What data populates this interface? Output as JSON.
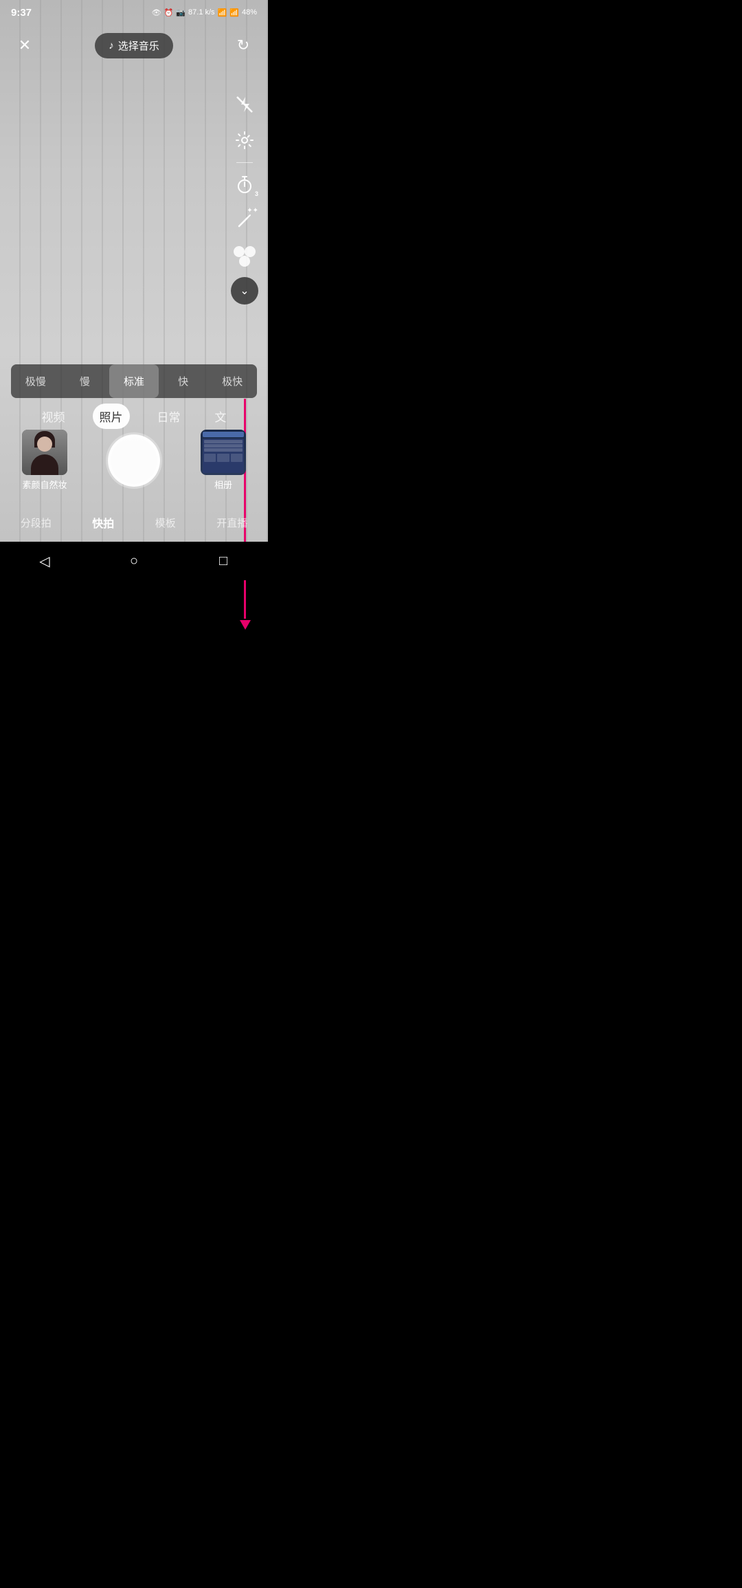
{
  "statusBar": {
    "time": "9:37",
    "batteryPercent": "48%",
    "networkSpeed": "87.1 k/s"
  },
  "topBar": {
    "closeLabel": "×",
    "musicLabel": "选择音乐",
    "rotateLabel": "↺"
  },
  "rightControls": {
    "flashLabel": "flash-off",
    "settingsLabel": "settings",
    "timerLabel": "timer",
    "timerBadge": "3",
    "magicLabel": "magic-wand",
    "beautyLabel": "beauty",
    "chevronLabel": "chevron-down"
  },
  "speedOptions": [
    {
      "label": "极慢",
      "active": false
    },
    {
      "label": "慢",
      "active": false
    },
    {
      "label": "标准",
      "active": true
    },
    {
      "label": "快",
      "active": false
    },
    {
      "label": "极快",
      "active": false
    }
  ],
  "modeTabs": [
    {
      "label": "视频",
      "active": false
    },
    {
      "label": "照片",
      "active": true
    },
    {
      "label": "日常",
      "active": false
    },
    {
      "label": "文",
      "active": false
    }
  ],
  "cameraControls": {
    "galleryLabel": "素颜自然妆",
    "albumLabel": "相册"
  },
  "bottomNav": [
    {
      "label": "分段拍",
      "active": false
    },
    {
      "label": "快拍",
      "active": true
    },
    {
      "label": "模板",
      "active": false
    },
    {
      "label": "开直播",
      "active": false
    }
  ],
  "sysNav": {
    "backLabel": "◁",
    "homeLabel": "○",
    "recentLabel": "□"
  }
}
